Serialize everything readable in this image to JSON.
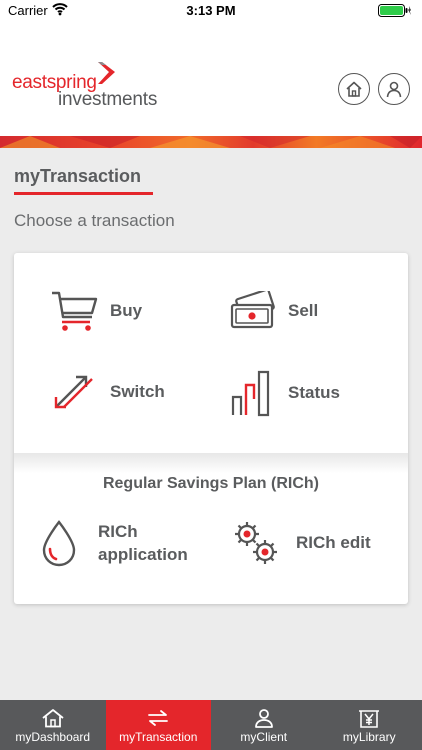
{
  "status_bar": {
    "carrier": "Carrier",
    "time": "3:13 PM"
  },
  "header": {
    "logo_line1": "eastspring",
    "logo_line2": "investments",
    "home_icon": "home-icon",
    "profile_icon": "user-icon"
  },
  "page": {
    "title": "myTransaction",
    "subtitle": "Choose a transaction"
  },
  "transactions": {
    "buy": {
      "label": "Buy",
      "icon": "cart-icon"
    },
    "sell": {
      "label": "Sell",
      "icon": "cash-icon"
    },
    "switch": {
      "label": "Switch",
      "icon": "switch-icon"
    },
    "status": {
      "label": "Status",
      "icon": "bar-chart-icon"
    }
  },
  "rsp": {
    "title": "Regular Savings Plan (RICh)",
    "application": {
      "label_line1": "RICh",
      "label_line2": "application",
      "icon": "droplet-icon"
    },
    "edit": {
      "label": "RICh edit",
      "icon": "gears-icon"
    }
  },
  "bottom_nav": {
    "items": [
      {
        "label": "myDashboard",
        "icon": "home-icon"
      },
      {
        "label": "myTransaction",
        "icon": "transfer-icon"
      },
      {
        "label": "myClient",
        "icon": "person-icon"
      },
      {
        "label": "myLibrary",
        "icon": "library-yen-icon"
      }
    ],
    "active_index": 1
  },
  "colors": {
    "accent": "#e4262b",
    "text": "#5a5c5e",
    "nav_bg": "#58595b"
  }
}
